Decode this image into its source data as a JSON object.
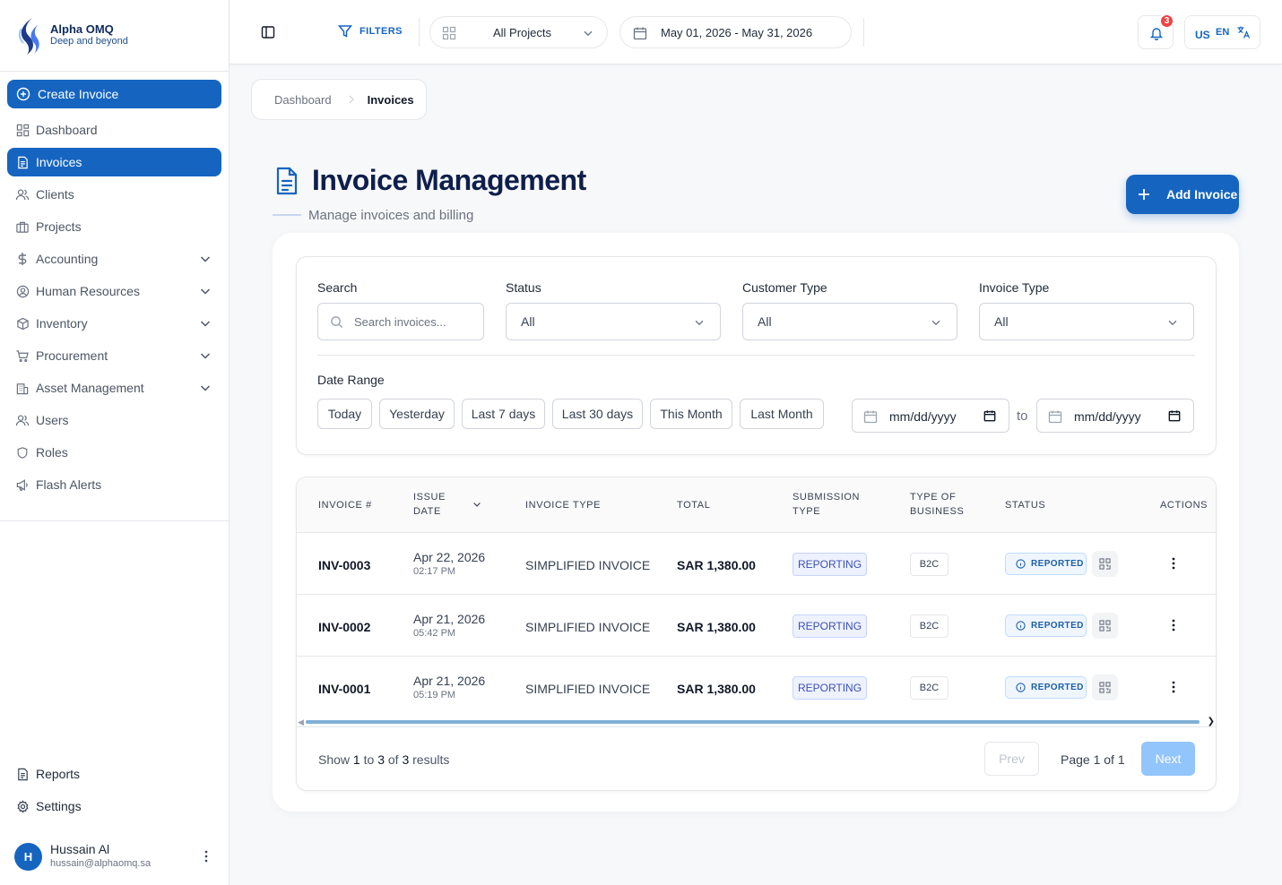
{
  "brand": {
    "name": "Alpha OMQ",
    "tagline": "Deep and beyond"
  },
  "sidebar": {
    "create_label": "Create Invoice",
    "items": [
      {
        "label": "Dashboard",
        "icon": "dashboard-icon",
        "active": false,
        "expandable": false
      },
      {
        "label": "Invoices",
        "icon": "document-icon",
        "active": true,
        "expandable": false
      },
      {
        "label": "Clients",
        "icon": "users-icon",
        "active": false,
        "expandable": false
      },
      {
        "label": "Projects",
        "icon": "briefcase-icon",
        "active": false,
        "expandable": false
      },
      {
        "label": "Accounting",
        "icon": "dollar-icon",
        "active": false,
        "expandable": true
      },
      {
        "label": "Human Resources",
        "icon": "user-circle-icon",
        "active": false,
        "expandable": true
      },
      {
        "label": "Inventory",
        "icon": "box-icon",
        "active": false,
        "expandable": true
      },
      {
        "label": "Procurement",
        "icon": "cart-icon",
        "active": false,
        "expandable": true
      },
      {
        "label": "Asset Management",
        "icon": "building-icon",
        "active": false,
        "expandable": true
      },
      {
        "label": "Users",
        "icon": "users-icon",
        "active": false,
        "expandable": false
      },
      {
        "label": "Roles",
        "icon": "shield-icon",
        "active": false,
        "expandable": false
      },
      {
        "label": "Flash Alerts",
        "icon": "megaphone-icon",
        "active": false,
        "expandable": false
      }
    ],
    "bottom": [
      {
        "label": "Reports",
        "icon": "report-icon"
      },
      {
        "label": "Settings",
        "icon": "gear-icon"
      }
    ],
    "user": {
      "initial": "H",
      "name": "Hussain Al",
      "email": "hussain@alphaomq.sa"
    }
  },
  "topbar": {
    "filters_label": "FILTERS",
    "project_select": "All Projects",
    "date_range": "May 01, 2026 - May 31, 2026",
    "notification_count": "3",
    "flag": "US",
    "lang": "EN"
  },
  "breadcrumb": {
    "home": "Dashboard",
    "current": "Invoices"
  },
  "page": {
    "title": "Invoice Management",
    "subtitle": "Manage invoices and billing",
    "add_button": "Add Invoice"
  },
  "filters": {
    "search_label": "Search",
    "search_placeholder": "Search invoices...",
    "status_label": "Status",
    "status_value": "All",
    "customer_type_label": "Customer Type",
    "customer_type_value": "All",
    "invoice_type_label": "Invoice Type",
    "invoice_type_value": "All",
    "date_range_label": "Date Range",
    "quick_ranges": [
      "Today",
      "Yesterday",
      "Last 7 days",
      "Last 30 days",
      "This Month",
      "Last Month"
    ],
    "date_from": "mm/dd/yyyy",
    "date_to": "mm/dd/yyyy",
    "to_label": "to"
  },
  "table": {
    "headers": {
      "invoice": "INVOICE #",
      "issue_date_1": "ISSUE",
      "issue_date_2": "DATE",
      "invoice_type": "INVOICE TYPE",
      "total": "TOTAL",
      "submission_1": "SUBMISSION",
      "submission_2": "TYPE",
      "business_1": "TYPE OF",
      "business_2": "BUSINESS",
      "status": "STATUS",
      "actions": "ACTIONS"
    },
    "rows": [
      {
        "invoice": "INV-0003",
        "date": "Apr 22, 2026",
        "time": "02:17 PM",
        "type": "SIMPLIFIED INVOICE",
        "total": "SAR 1,380.00",
        "submission": "REPORTING",
        "business": "B2C",
        "status": "REPORTED"
      },
      {
        "invoice": "INV-0002",
        "date": "Apr 21, 2026",
        "time": "05:42 PM",
        "type": "SIMPLIFIED INVOICE",
        "total": "SAR 1,380.00",
        "submission": "REPORTING",
        "business": "B2C",
        "status": "REPORTED"
      },
      {
        "invoice": "INV-0001",
        "date": "Apr 21, 2026",
        "time": "05:19 PM",
        "type": "SIMPLIFIED INVOICE",
        "total": "SAR 1,380.00",
        "submission": "REPORTING",
        "business": "B2C",
        "status": "REPORTED"
      }
    ]
  },
  "pagination": {
    "show": "Show",
    "from": "1",
    "to_word": "to",
    "to": "3",
    "of_word": "of",
    "total": "3",
    "results": "results",
    "prev": "Prev",
    "page_indicator": "Page 1 of 1",
    "next": "Next"
  },
  "colors": {
    "primary": "#1565c0",
    "badge": "#ef4444",
    "title": "#0f1f4b"
  }
}
